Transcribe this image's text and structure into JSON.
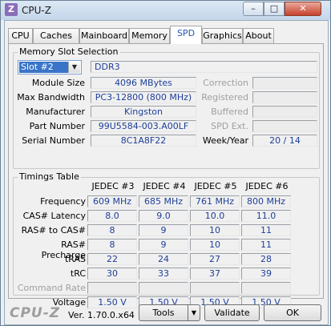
{
  "window": {
    "title": "CPU-Z",
    "icon_letter": "Z",
    "minimize_glyph": "–",
    "maximize_glyph": "□",
    "close_glyph": "✕"
  },
  "tabs": [
    "CPU",
    "Caches",
    "Mainboard",
    "Memory",
    "SPD",
    "Graphics",
    "About"
  ],
  "active_tab": "SPD",
  "memory_slot": {
    "group_title": "Memory Slot Selection",
    "slot_selected": "Slot #2",
    "memory_type": "DDR3",
    "module_size_label": "Module Size",
    "module_size": "4096 MBytes",
    "max_bandwidth_label": "Max Bandwidth",
    "max_bandwidth": "PC3-12800 (800 MHz)",
    "manufacturer_label": "Manufacturer",
    "manufacturer": "Kingston",
    "part_number_label": "Part Number",
    "part_number": "99U5584-003.A00LF",
    "serial_number_label": "Serial Number",
    "serial_number": "8C1A8F22",
    "correction_label": "Correction",
    "correction": "",
    "registered_label": "Registered",
    "registered": "",
    "buffered_label": "Buffered",
    "buffered": "",
    "spd_ext_label": "SPD Ext.",
    "spd_ext": "",
    "week_year_label": "Week/Year",
    "week_year": "20 / 14"
  },
  "timings": {
    "group_title": "Timings Table",
    "columns": [
      "JEDEC #3",
      "JEDEC #4",
      "JEDEC #5",
      "JEDEC #6"
    ],
    "rows": [
      {
        "label": "Frequency",
        "values": [
          "609 MHz",
          "685 MHz",
          "761 MHz",
          "800 MHz"
        ],
        "dim": false
      },
      {
        "label": "CAS# Latency",
        "values": [
          "8.0",
          "9.0",
          "10.0",
          "11.0"
        ],
        "dim": false
      },
      {
        "label": "RAS# to CAS#",
        "values": [
          "8",
          "9",
          "10",
          "11"
        ],
        "dim": false
      },
      {
        "label": "RAS# Precharge",
        "values": [
          "8",
          "9",
          "10",
          "11"
        ],
        "dim": false
      },
      {
        "label": "tRAS",
        "values": [
          "22",
          "24",
          "27",
          "28"
        ],
        "dim": false
      },
      {
        "label": "tRC",
        "values": [
          "30",
          "33",
          "37",
          "39"
        ],
        "dim": false
      },
      {
        "label": "Command Rate",
        "values": [
          "",
          "",
          "",
          ""
        ],
        "dim": true
      },
      {
        "label": "Voltage",
        "values": [
          "1.50 V",
          "1.50 V",
          "1.50 V",
          "1.50 V"
        ],
        "dim": false
      }
    ]
  },
  "footer": {
    "logo": "CPU-Z",
    "version": "Ver. 1.70.0.x64",
    "tools_label": "Tools",
    "tools_arrow": "▼",
    "validate_label": "Validate",
    "ok_label": "OK"
  }
}
